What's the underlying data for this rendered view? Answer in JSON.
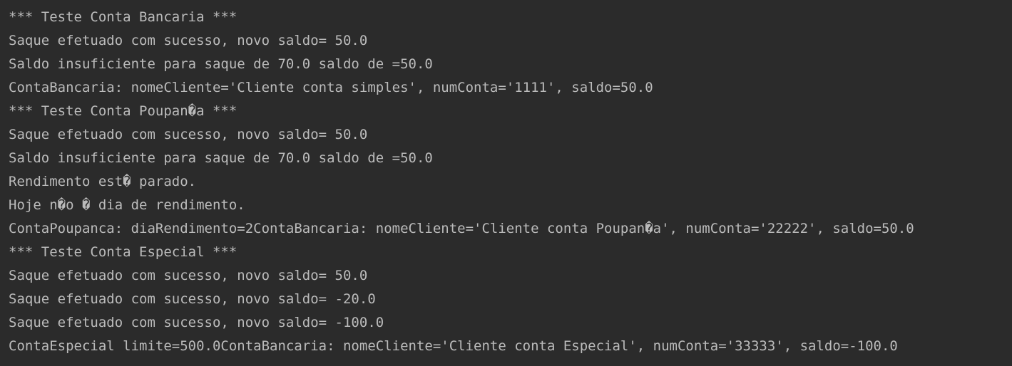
{
  "console": {
    "lines": [
      "*** Teste Conta Bancaria ***",
      "Saque efetuado com sucesso, novo saldo= 50.0",
      "Saldo insuficiente para saque de 70.0 saldo de =50.0",
      "ContaBancaria: nomeCliente='Cliente conta simples', numConta='1111', saldo=50.0",
      "*** Teste Conta Poupan�a ***",
      "Saque efetuado com sucesso, novo saldo= 50.0",
      "Saldo insuficiente para saque de 70.0 saldo de =50.0",
      "Rendimento est� parado.",
      "Hoje n�o � dia de rendimento.",
      "ContaPoupanca: diaRendimento=2ContaBancaria: nomeCliente='Cliente conta Poupan�a', numConta='22222', saldo=50.0",
      "*** Teste Conta Especial ***",
      "Saque efetuado com sucesso, novo saldo= 50.0",
      "Saque efetuado com sucesso, novo saldo= -20.0",
      "Saque efetuado com sucesso, novo saldo= -100.0",
      "ContaEspecial limite=500.0ContaBancaria: nomeCliente='Cliente conta Especial', numConta='33333', saldo=-100.0"
    ]
  },
  "colors": {
    "background": "#2b2b2b",
    "text": "#bbbbbb"
  }
}
